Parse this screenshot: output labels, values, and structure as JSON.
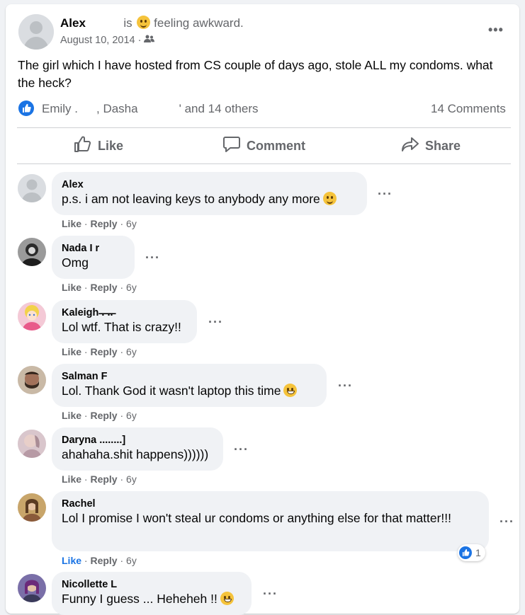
{
  "post": {
    "author": "Alex",
    "is_text": "is",
    "feeling_text": "feeling awkward.",
    "date": "August 10, 2014 ·",
    "body": "The girl which I have hosted from CS couple of days ago, stole ALL my condoms. what the heck?",
    "reactions_text_1": "Emily .",
    "reactions_text_2": ", Dasha",
    "reactions_text_3": "' and 14 others",
    "comments_count": "14 Comments"
  },
  "actions": {
    "like": "Like",
    "comment": "Comment",
    "share": "Share"
  },
  "comment_meta": {
    "like": "Like",
    "reply": "Reply",
    "sep": "·",
    "age": "6y"
  },
  "comments": [
    {
      "name": "Alex",
      "text": "p.s. i am not leaving keys to anybody any more"
    },
    {
      "name": "Nada I      r",
      "text": "Omg"
    },
    {
      "name": "Kaleigh ̶.̶ ̶.̶.̶",
      "text": "Lol wtf. That is crazy!!"
    },
    {
      "name": "Salman F",
      "text": "Lol. Thank God it wasn't laptop this time"
    },
    {
      "name": "Daryna ........]",
      "text": "ahahaha.shit happens))))))"
    },
    {
      "name": "Rachel",
      "text": "Lol I promise I won't steal ur condoms or anything else for that matter!!!"
    },
    {
      "name": "Nicollette L",
      "text": "Funny I guess ... Heheheh !!"
    }
  ],
  "rachel_reaction_count": "1",
  "colors": {
    "accent": "#1b74e4",
    "bubble": "#f0f2f5",
    "muted": "#65676b"
  }
}
